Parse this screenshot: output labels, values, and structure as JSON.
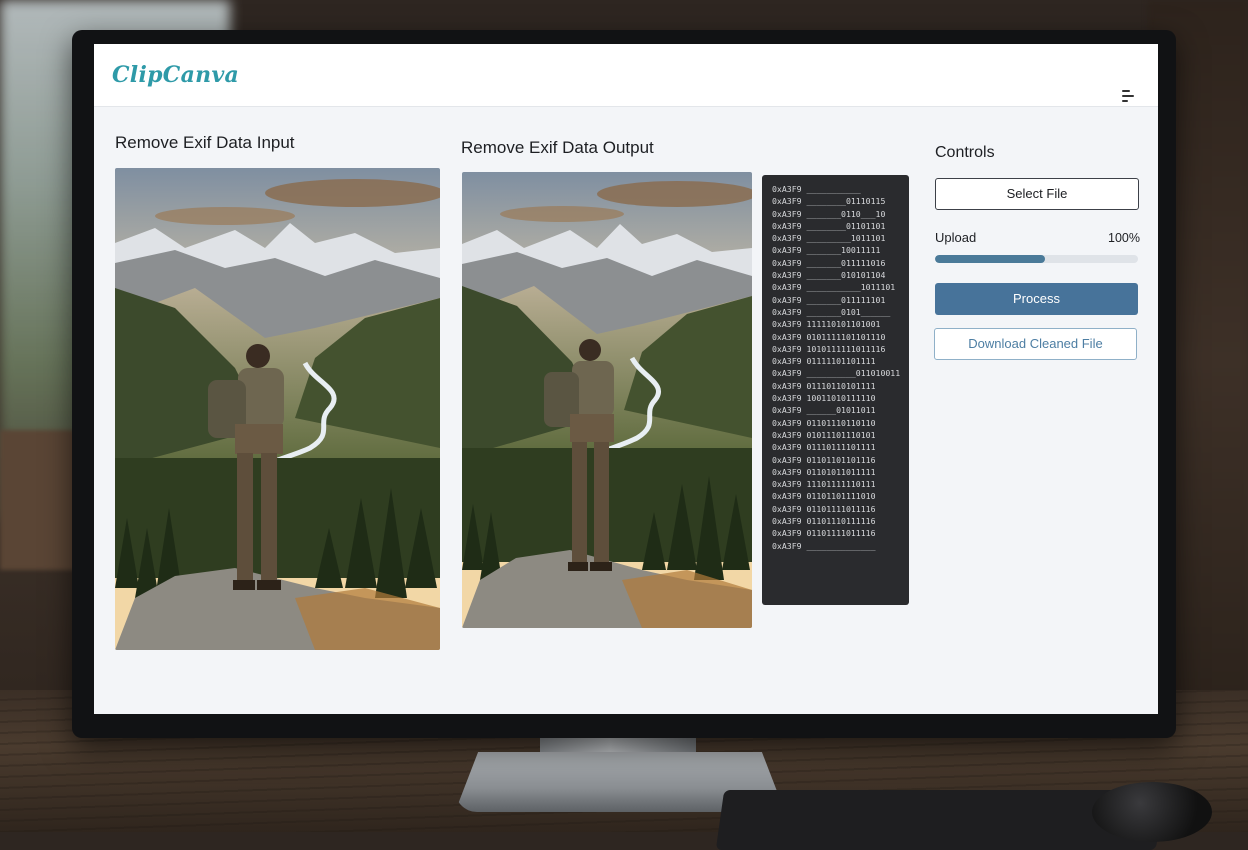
{
  "app": {
    "logo": "ClipCanva"
  },
  "header": {
    "menu_icon": "menu-icon"
  },
  "input_panel": {
    "title": "Remove Exif Data Input"
  },
  "output_panel": {
    "title": "Remove Exif Data Output"
  },
  "controls": {
    "title": "Controls",
    "select_file_label": "Select File",
    "upload_label": "Upload",
    "upload_percent": "100%",
    "upload_progress": 0.54,
    "process_label": "Process",
    "download_label": "Download Cleaned File"
  },
  "hex_dump": [
    "0xA3F9 ___________",
    "0xA3F9 ________01110115",
    "0xA3F9 _______0110___10",
    "0xA3F9 ________01101101",
    "0xA3F9 _________1011101",
    "0xA3F9 _______10011111",
    "0xA3F9 _______011111016",
    "0xA3F9 _______010101104",
    "0xA3F9 ___________1011101",
    "0xA3F9 _______011111101",
    "0xA3F9 _______0101______",
    "0xA3F9 111110101101001",
    "0xA3F9 0101111101101110",
    "0xA3F9 1010111111011116",
    "0xA3F9 01111101101111",
    "0xA3F9 __________011010011",
    "0xA3F9 01110110101111",
    "0xA3F9 10011010111110",
    "0xA3F9 ______01011011",
    "0xA3F9 01101110110110",
    "0xA3F9 01011101110101",
    "0xA3F9 01110111101111",
    "0xA3F9 01101101101116",
    "0xA3F9 01101011011111",
    "0xA3F9 11101111110111",
    "0xA3F9 01101101111010",
    "0xA3F9 01101111011116",
    "0xA3F9 01101110111116",
    "0xA3F9 01101111011116",
    "0xA3F9 ______________"
  ],
  "colors": {
    "accent": "#47739a",
    "logo": "#2e9aa8",
    "progress": "#4a7a99",
    "hex_bg": "#2a2b2e"
  }
}
